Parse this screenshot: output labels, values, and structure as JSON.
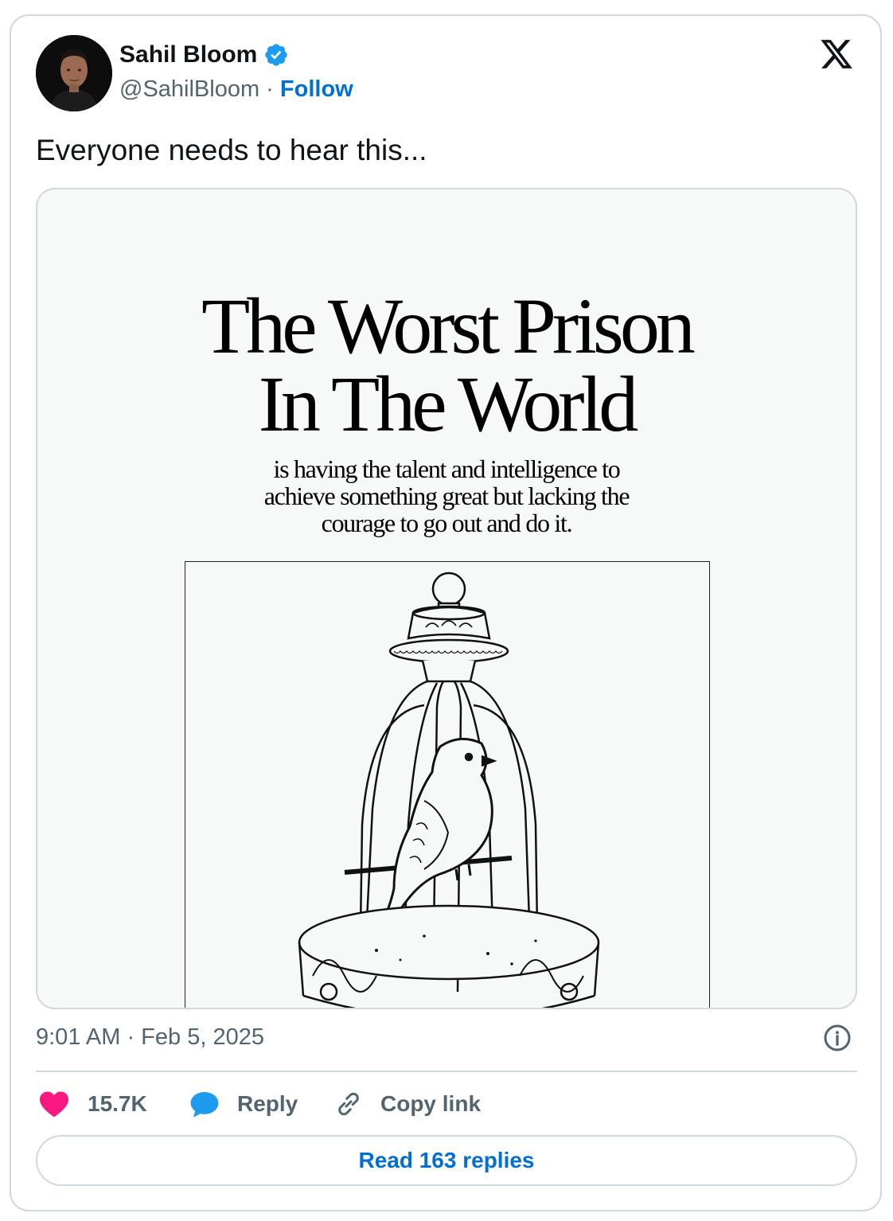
{
  "author": {
    "name": "Sahil Bloom",
    "handle": "@SahilBloom",
    "separator": " · ",
    "follow_label": "Follow",
    "verified_color": "#1d9bf0"
  },
  "tweet": {
    "text": "Everyone needs to hear this..."
  },
  "media": {
    "title_line1": "The Worst Prison",
    "title_line2": "In The World",
    "subtitle_line1": "is having the talent and intelligence to",
    "subtitle_line2": "achieve something great but lacking the",
    "subtitle_line3": "courage to go out and do it."
  },
  "meta": {
    "timestamp": "9:01 AM · Feb 5, 2025"
  },
  "actions": {
    "like_count": "15.7K",
    "reply_label": "Reply",
    "copy_label": "Copy link",
    "like_color": "#f91880",
    "reply_color": "#1d9bf0"
  },
  "replies": {
    "label": "Read 163 replies"
  },
  "icons": {
    "brand": "x-logo-icon",
    "verified": "verified-badge-icon",
    "info": "info-icon",
    "like": "heart-icon",
    "reply": "speech-bubble-icon",
    "copy": "link-icon"
  }
}
